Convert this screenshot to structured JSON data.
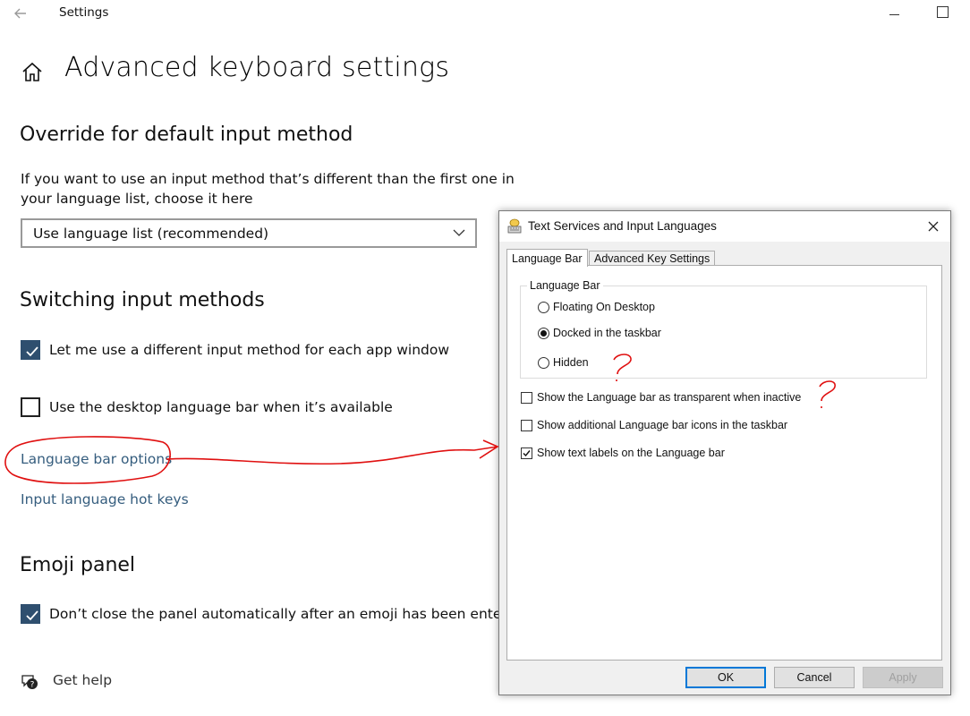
{
  "window": {
    "app_title": "Settings",
    "back_icon": "back-arrow-icon",
    "controls": [
      "minimize",
      "maximize"
    ]
  },
  "page": {
    "title": "Advanced keyboard settings",
    "home_icon": "home-icon"
  },
  "override": {
    "heading": "Override for default input method",
    "description_line1": "If you want to use an input method that’s different than the first one in",
    "description_line2": "your language list, choose it here",
    "dropdown_value": "Use language list (recommended)"
  },
  "switching": {
    "heading": "Switching input methods",
    "checkbox1_label": "Let me use a different input method for each app window",
    "checkbox1_checked": true,
    "checkbox2_label": "Use the desktop language bar when it’s available",
    "checkbox2_checked": false,
    "link_language_bar": "Language bar options",
    "link_hot_keys": "Input language hot keys"
  },
  "emoji": {
    "heading": "Emoji panel",
    "checkbox_label": "Don’t close the panel automatically after an emoji has been entered",
    "checkbox_checked": true
  },
  "help": {
    "label": "Get help",
    "icon": "help-chat-icon"
  },
  "dialog": {
    "title": "Text Services and Input Languages",
    "tabs": [
      "Language Bar",
      "Advanced Key Settings"
    ],
    "active_tab": "Language Bar",
    "group_label": "Language Bar",
    "radios": [
      {
        "label": "Floating On Desktop",
        "selected": false
      },
      {
        "label": "Docked in the taskbar",
        "selected": true
      },
      {
        "label": "Hidden",
        "selected": false
      }
    ],
    "checkboxes": [
      {
        "label": "Show the Language bar as transparent when inactive",
        "checked": false
      },
      {
        "label": "Show additional Language bar icons in the taskbar",
        "checked": false
      },
      {
        "label": "Show text labels on the Language bar",
        "checked": true
      }
    ],
    "buttons": {
      "ok": "OK",
      "cancel": "Cancel",
      "apply": "Apply"
    }
  },
  "colors": {
    "checkbox_fill": "#2f4f6f",
    "link": "#355d7e",
    "annotation": "#e01010",
    "default_button_border": "#0078d7"
  }
}
